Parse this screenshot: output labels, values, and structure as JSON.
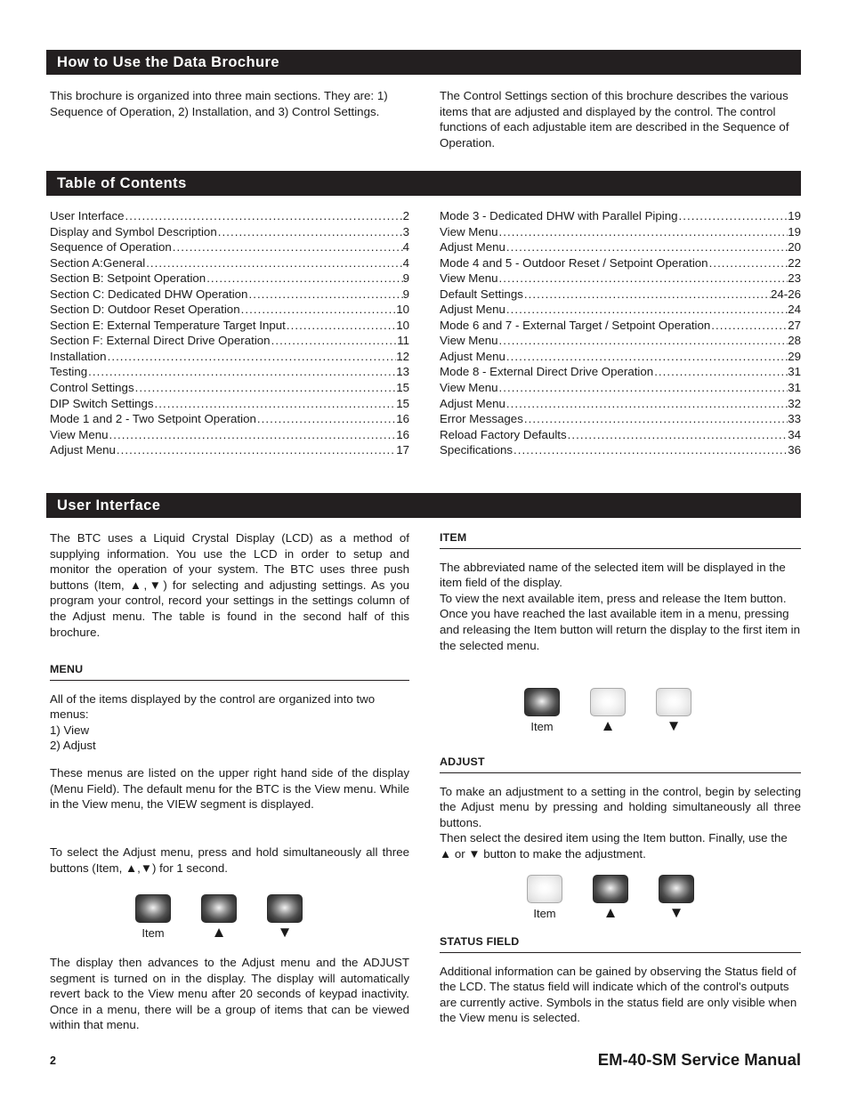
{
  "sections": {
    "how_to": {
      "title": "How to Use the Data Brochure",
      "left_text": "This brochure is organized into three main sections. They are: 1) Sequence of Operation, 2) Installation, and 3) Control Settings.",
      "right_text": "The Control Settings section of this brochure describes the various items that are adjusted and displayed by the control. The control functions of each adjustable item are described in the Sequence of Operation."
    },
    "toc": {
      "title": "Table of Contents",
      "left_entries": [
        {
          "label": "User Interface",
          "page": "2"
        },
        {
          "label": "Display and Symbol Description",
          "page": "3"
        },
        {
          "label": "Sequence of Operation",
          "page": "4"
        },
        {
          "label": "Section A:General",
          "page": "4"
        },
        {
          "label": "Section B: Setpoint Operation",
          "page": "9"
        },
        {
          "label": "Section C: Dedicated DHW Operation",
          "page": "9"
        },
        {
          "label": "Section D: Outdoor Reset Operation",
          "page": "10"
        },
        {
          "label": "Section E: External Temperature Target Input",
          "page": "10"
        },
        {
          "label": "Section F: External Direct Drive Operation",
          "page": "11"
        },
        {
          "label": "Installation",
          "page": "12"
        },
        {
          "label": "Testing",
          "page": "13"
        },
        {
          "label": "Control Settings",
          "page": "15"
        },
        {
          "label": "DIP Switch Settings",
          "page": "15"
        },
        {
          "label": "Mode 1 and 2 - Two Setpoint Operation",
          "page": "16"
        },
        {
          "label": "View Menu",
          "page": "16"
        },
        {
          "label": "Adjust Menu",
          "page": "17"
        }
      ],
      "right_entries": [
        {
          "label": "Mode 3 - Dedicated DHW with Parallel Piping",
          "page": "19"
        },
        {
          "label": "View Menu",
          "page": "19"
        },
        {
          "label": "Adjust Menu",
          "page": "20"
        },
        {
          "label": "Mode 4 and 5 - Outdoor Reset / Setpoint Operation",
          "page": "22"
        },
        {
          "label": "View Menu",
          "page": "23"
        },
        {
          "label": "Default Settings",
          "page": "24-26"
        },
        {
          "label": "Adjust Menu",
          "page": "24"
        },
        {
          "label": "Mode 6 and 7 - External Target / Setpoint Operation",
          "page": "27"
        },
        {
          "label": "View Menu",
          "page": "28"
        },
        {
          "label": "Adjust Menu",
          "page": "29"
        },
        {
          "label": "Mode 8 - External Direct Drive Operation",
          "page": "31"
        },
        {
          "label": "View Menu",
          "page": "31"
        },
        {
          "label": "Adjust Menu",
          "page": "32"
        },
        {
          "label": "Error Messages",
          "page": "33"
        },
        {
          "label": "Reload Factory Defaults",
          "page": "34"
        },
        {
          "label": "Specifications",
          "page": "36"
        }
      ]
    },
    "user_interface": {
      "title": "User Interface",
      "intro": "The BTC uses a Liquid Crystal Display (LCD) as a method of supplying information. You use the LCD in order to setup and monitor the operation of your system. The BTC uses three push buttons (Item, ▲,▼) for selecting and adjusting settings. As you program your control, record your settings in the settings column of the Adjust menu. The table is found in the second half of this brochure.",
      "menu": {
        "heading": "MENU",
        "p1": "All of the items displayed by the control are organized into two menus:",
        "item1": "1) View",
        "item2": "2) Adjust",
        "p2": "These menus are listed on the upper right hand side of the display (Menu Field). The default menu for the BTC is the View menu. While in the View menu, the VIEW segment is displayed.",
        "p3": "To select the Adjust menu, press and hold simultaneously all three buttons (Item, ▲,▼) for 1 second.",
        "p4": "The display then advances to the Adjust menu and the ADJUST segment is turned on in the display. The display will automatically revert back to the View menu after 20 seconds of keypad inactivity. Once in a menu, there will be a group of items that can be viewed within that menu."
      },
      "item": {
        "heading": "ITEM",
        "p1": "The abbreviated name of the selected item will be displayed in the item field of the display.",
        "p2": "To view the next available item, press and release the Item button.",
        "p3": "Once you have reached the last available item in a menu, pressing and releasing the Item button will return the display to the first item in the selected menu."
      },
      "adjust": {
        "heading": "ADJUST",
        "p1": "To make an adjustment to a setting in the control, begin by selecting the Adjust menu by pressing and holding simultaneously all three buttons.",
        "p2": "Then select the desired item using the Item button. Finally, use the ▲ or ▼ button to make the adjustment."
      },
      "status": {
        "heading": "STATUS FIELD",
        "p1": "Additional information can be gained by observing the Status field of the LCD. The status field will indicate which of the control's outputs are currently active. Symbols in the status field are only visible when the View menu is selected."
      }
    }
  },
  "buttons": {
    "item_label": "Item",
    "up_glyph": "▲",
    "down_glyph": "▼",
    "keypad_menu": {
      "item_state": "dark",
      "up_state": "dark",
      "down_state": "dark"
    },
    "keypad_item": {
      "item_state": "dark",
      "up_state": "light",
      "down_state": "light"
    },
    "keypad_adjust": {
      "item_state": "light",
      "up_state": "dark",
      "down_state": "dark"
    }
  },
  "footer": {
    "page_number": "2",
    "manual_title": "EM-40-SM Service Manual"
  },
  "colors": {
    "bar_background": "#231f20",
    "bar_text": "#ffffff",
    "body_text": "#1a1a1a"
  }
}
